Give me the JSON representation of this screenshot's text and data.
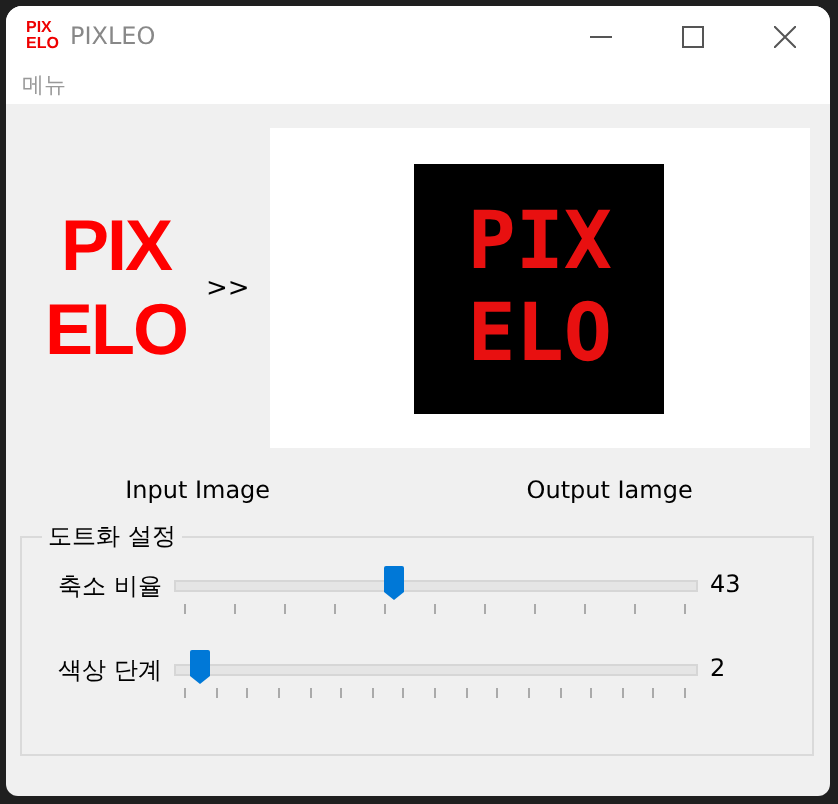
{
  "window": {
    "title": "PIXLEO",
    "icon_text": [
      "PIX",
      "ELO"
    ]
  },
  "menu": [
    "메뉴"
  ],
  "input_image": {
    "lines": [
      "PIX",
      "ELO"
    ]
  },
  "arrow": ">>",
  "output_image": {
    "lines": [
      "PIX",
      "ELO"
    ]
  },
  "captions": [
    "Input Image",
    "Output Iamge"
  ],
  "settings": {
    "title": "도트화 설정",
    "sliders": [
      {
        "label": "축소 비율",
        "level": 0.42,
        "reading": "43"
      },
      {
        "label": "색상 단계",
        "level": 0.03,
        "reading": "2"
      }
    ]
  }
}
